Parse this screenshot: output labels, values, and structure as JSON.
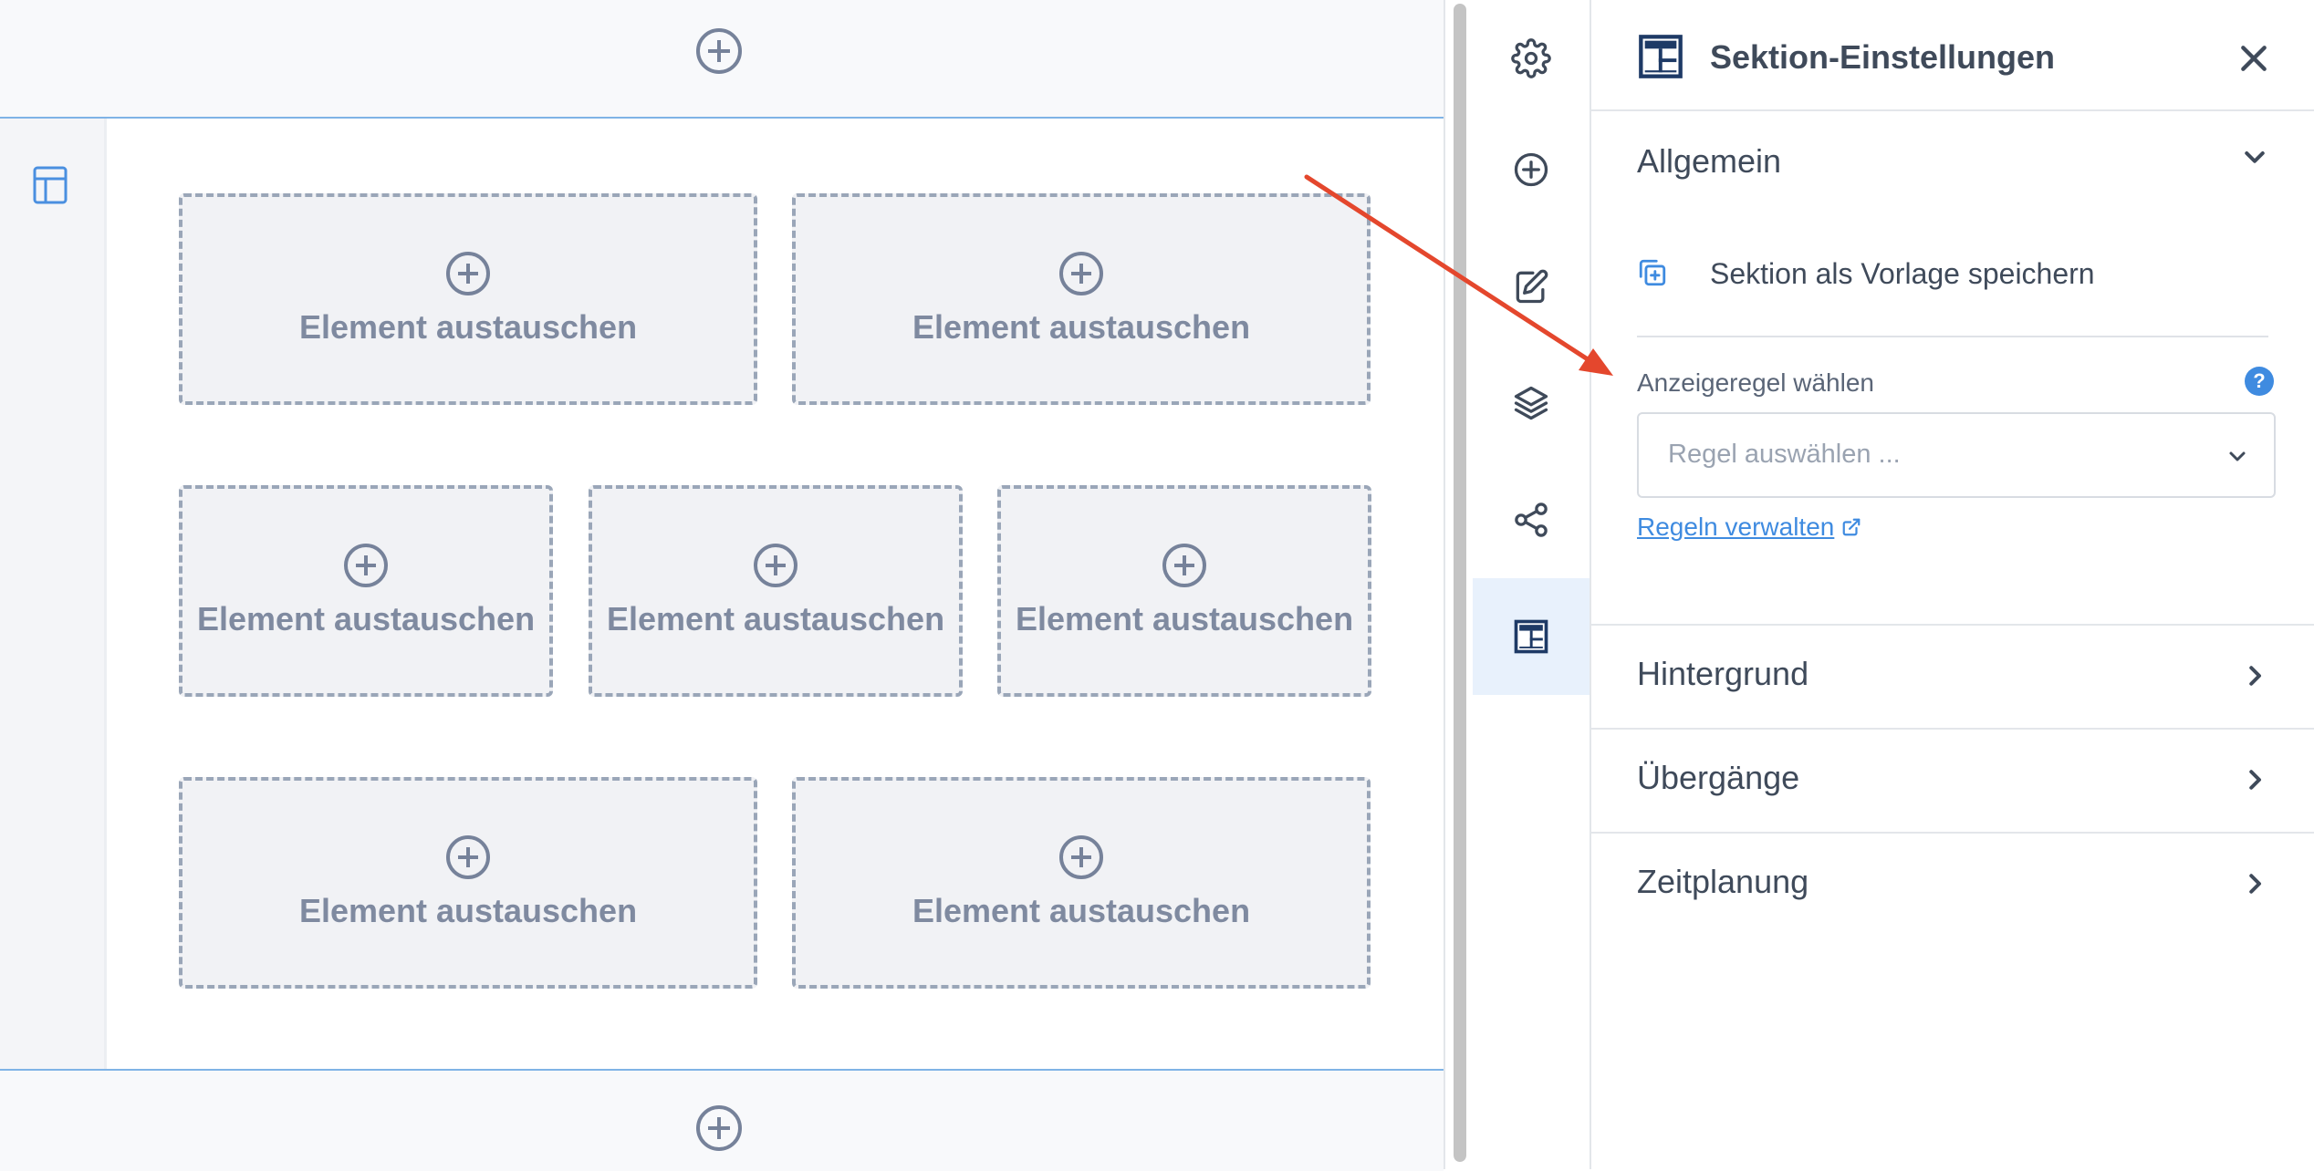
{
  "panel": {
    "title": "Sektion-Einstellungen",
    "sections": {
      "general": "Allgemein",
      "background": "Hintergrund",
      "transitions": "Übergänge",
      "scheduling": "Zeitplanung"
    },
    "save_template": "Sektion als Vorlage speichern",
    "display_rule_label": "Anzeigeregel wählen",
    "help_symbol": "?",
    "rule_select_placeholder": "Regel auswählen ...",
    "manage_rules_link": "Regeln verwalten"
  },
  "canvas": {
    "elements": [
      "Element austauschen",
      "Element austauschen",
      "Element austauschen",
      "Element austauschen",
      "Element austauschen",
      "Element austauschen",
      "Element austauschen"
    ]
  },
  "icon_rail": [
    "gear-icon",
    "add-icon",
    "edit-icon",
    "layers-icon",
    "share-icon",
    "section-layout-icon"
  ],
  "colors": {
    "accent": "#3f8be0",
    "annotation_arrow": "#e4472d",
    "active_rail": "#e8f1fc",
    "dark_icon": "#1e3a66"
  }
}
